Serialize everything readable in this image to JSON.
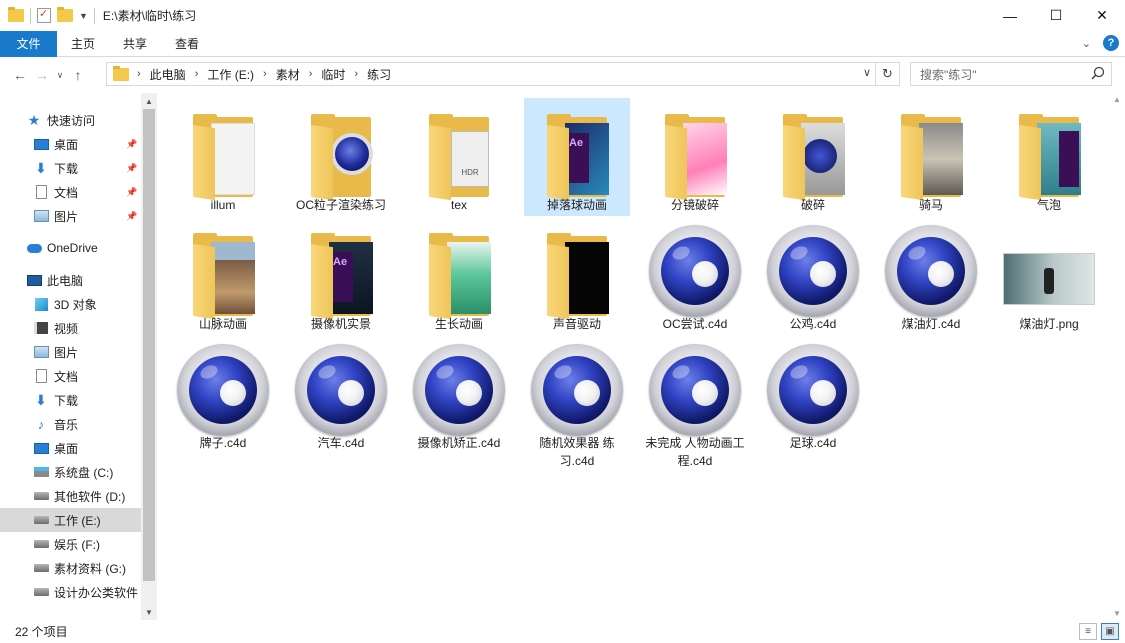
{
  "window": {
    "title": "E:\\素材\\临时\\练习",
    "controls": [
      "minimize",
      "maximize",
      "close"
    ]
  },
  "ribbon": {
    "tabs": [
      "文件",
      "主页",
      "共享",
      "查看"
    ]
  },
  "address": {
    "crumbs": [
      "此电脑",
      "工作 (E:)",
      "素材",
      "临时",
      "练习"
    ]
  },
  "search": {
    "placeholder": "搜索\"练习\""
  },
  "sidebar": {
    "items": [
      {
        "label": "快速访问",
        "icon": "star-icon",
        "pinned": false
      },
      {
        "label": "桌面",
        "icon": "desktop-icon",
        "pinned": true
      },
      {
        "label": "下载",
        "icon": "download-icon",
        "pinned": true
      },
      {
        "label": "文档",
        "icon": "document-icon",
        "pinned": true
      },
      {
        "label": "图片",
        "icon": "pictures-icon",
        "pinned": true
      },
      {
        "label": "OneDrive",
        "icon": "cloud-icon",
        "pinned": false
      },
      {
        "label": "此电脑",
        "icon": "computer-icon",
        "pinned": false
      },
      {
        "label": "3D 对象",
        "icon": "3d-objects-icon",
        "pinned": false
      },
      {
        "label": "视频",
        "icon": "video-icon",
        "pinned": false
      },
      {
        "label": "图片",
        "icon": "pictures-icon",
        "pinned": false
      },
      {
        "label": "文档",
        "icon": "document-icon",
        "pinned": false
      },
      {
        "label": "下载",
        "icon": "download-icon",
        "pinned": false
      },
      {
        "label": "音乐",
        "icon": "music-icon",
        "pinned": false
      },
      {
        "label": "桌面",
        "icon": "desktop-icon",
        "pinned": false
      },
      {
        "label": "系统盘 (C:)",
        "icon": "system-drive-icon",
        "pinned": false
      },
      {
        "label": "其他软件 (D:)",
        "icon": "drive-icon",
        "pinned": false
      },
      {
        "label": "工作 (E:)",
        "icon": "drive-icon",
        "pinned": false,
        "selected": true
      },
      {
        "label": "娱乐 (F:)",
        "icon": "drive-icon",
        "pinned": false
      },
      {
        "label": "素材资料 (G:)",
        "icon": "drive-icon",
        "pinned": false
      },
      {
        "label": "设计办公类软件",
        "icon": "drive-icon",
        "pinned": false
      }
    ]
  },
  "files": [
    {
      "name": "illum",
      "kind": "folder",
      "preview": "paper"
    },
    {
      "name": "OC粒子渲染练习",
      "kind": "folder",
      "preview": "c4d"
    },
    {
      "name": "tex",
      "kind": "folder",
      "preview": "hdr"
    },
    {
      "name": "掉落球动画",
      "kind": "folder",
      "preview": "ae-dots",
      "selected": true
    },
    {
      "name": "分镜破碎",
      "kind": "folder",
      "preview": "pink-figure"
    },
    {
      "name": "破碎",
      "kind": "folder",
      "preview": "c4d-gray"
    },
    {
      "name": "骑马",
      "kind": "folder",
      "preview": "street"
    },
    {
      "name": "气泡",
      "kind": "folder",
      "preview": "teal-ae"
    },
    {
      "name": "山脉动画",
      "kind": "folder",
      "preview": "mountain"
    },
    {
      "name": "摄像机实景",
      "kind": "folder",
      "preview": "ae-dark"
    },
    {
      "name": "生长动画",
      "kind": "folder",
      "preview": "green"
    },
    {
      "name": "声音驱动",
      "kind": "folder",
      "preview": "black"
    },
    {
      "name": "OC尝试.c4d",
      "kind": "c4d"
    },
    {
      "name": "公鸡.c4d",
      "kind": "c4d"
    },
    {
      "name": "煤油灯.c4d",
      "kind": "c4d"
    },
    {
      "name": "煤油灯.png",
      "kind": "png"
    },
    {
      "name": "牌子.c4d",
      "kind": "c4d"
    },
    {
      "name": "汽车.c4d",
      "kind": "c4d"
    },
    {
      "name": "摄像机矫正.c4d",
      "kind": "c4d"
    },
    {
      "name": "随机效果器 练习.c4d",
      "kind": "c4d"
    },
    {
      "name": "未完成 人物动画工程.c4d",
      "kind": "c4d"
    },
    {
      "name": "足球.c4d",
      "kind": "c4d"
    }
  ],
  "status": {
    "count_text": "22 个项目"
  },
  "colors": {
    "accent": "#1979ca",
    "selection": "#cce8ff",
    "folder": "#e9b949"
  }
}
